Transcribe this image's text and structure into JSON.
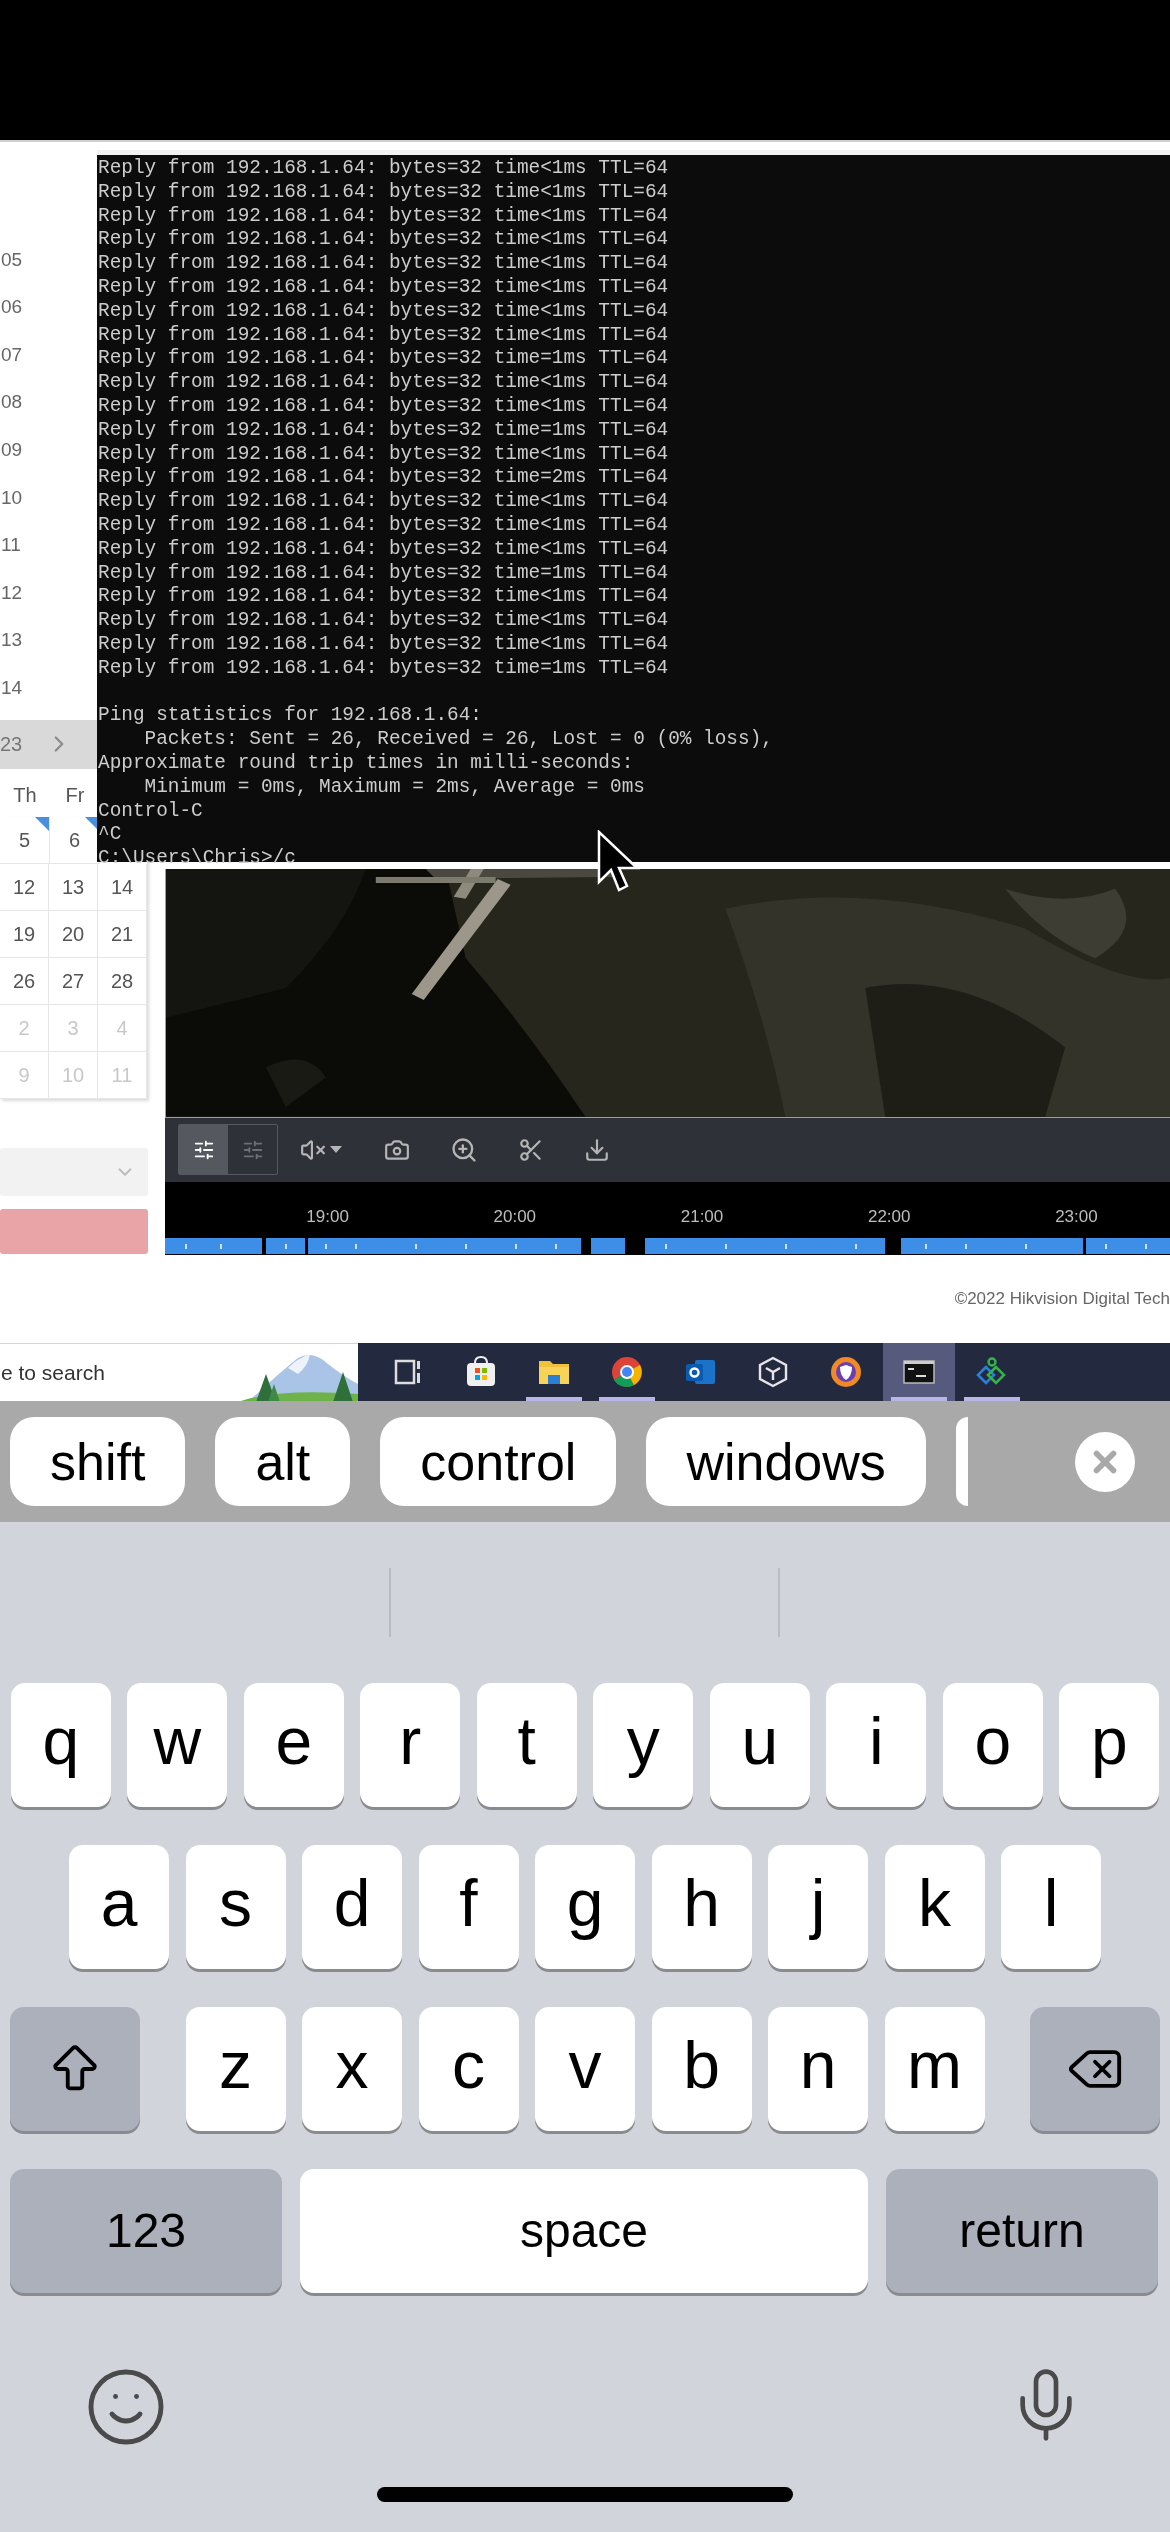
{
  "calendar": {
    "times": [
      "05",
      "06",
      "07",
      "08",
      "09",
      "10",
      "11",
      "12",
      "13",
      "14"
    ],
    "month_label": "23",
    "weekdays": [
      "Th",
      "Fr"
    ],
    "rows": [
      {
        "cells": [
          {
            "day": "5",
            "muted": false,
            "marked": true
          },
          {
            "day": "6",
            "muted": false,
            "marked": true
          }
        ]
      },
      {
        "cells": [
          {
            "day": "12",
            "muted": false,
            "marked": false
          },
          {
            "day": "13",
            "muted": false,
            "marked": false
          },
          {
            "day": "14",
            "muted": false,
            "marked": false
          }
        ]
      },
      {
        "cells": [
          {
            "day": "19",
            "muted": false,
            "marked": false
          },
          {
            "day": "20",
            "muted": false,
            "marked": false
          },
          {
            "day": "21",
            "muted": false,
            "marked": false
          }
        ]
      },
      {
        "cells": [
          {
            "day": "26",
            "muted": false,
            "marked": false
          },
          {
            "day": "27",
            "muted": false,
            "marked": false
          },
          {
            "day": "28",
            "muted": false,
            "marked": false
          }
        ]
      },
      {
        "cells": [
          {
            "day": "2",
            "muted": true,
            "marked": false
          },
          {
            "day": "3",
            "muted": true,
            "marked": false
          },
          {
            "day": "4",
            "muted": true,
            "marked": false
          }
        ]
      },
      {
        "cells": [
          {
            "day": "9",
            "muted": true,
            "marked": false
          },
          {
            "day": "10",
            "muted": true,
            "marked": false
          },
          {
            "day": "11",
            "muted": true,
            "marked": false
          }
        ]
      }
    ]
  },
  "terminal": {
    "replies": [
      "Reply from 192.168.1.64: bytes=32 time<1ms TTL=64",
      "Reply from 192.168.1.64: bytes=32 time<1ms TTL=64",
      "Reply from 192.168.1.64: bytes=32 time<1ms TTL=64",
      "Reply from 192.168.1.64: bytes=32 time<1ms TTL=64",
      "Reply from 192.168.1.64: bytes=32 time<1ms TTL=64",
      "Reply from 192.168.1.64: bytes=32 time<1ms TTL=64",
      "Reply from 192.168.1.64: bytes=32 time<1ms TTL=64",
      "Reply from 192.168.1.64: bytes=32 time<1ms TTL=64",
      "Reply from 192.168.1.64: bytes=32 time=1ms TTL=64",
      "Reply from 192.168.1.64: bytes=32 time<1ms TTL=64",
      "Reply from 192.168.1.64: bytes=32 time<1ms TTL=64",
      "Reply from 192.168.1.64: bytes=32 time=1ms TTL=64",
      "Reply from 192.168.1.64: bytes=32 time<1ms TTL=64",
      "Reply from 192.168.1.64: bytes=32 time=2ms TTL=64",
      "Reply from 192.168.1.64: bytes=32 time<1ms TTL=64",
      "Reply from 192.168.1.64: bytes=32 time<1ms TTL=64",
      "Reply from 192.168.1.64: bytes=32 time<1ms TTL=64",
      "Reply from 192.168.1.64: bytes=32 time=1ms TTL=64",
      "Reply from 192.168.1.64: bytes=32 time<1ms TTL=64",
      "Reply from 192.168.1.64: bytes=32 time<1ms TTL=64",
      "Reply from 192.168.1.64: bytes=32 time<1ms TTL=64",
      "Reply from 192.168.1.64: bytes=32 time=1ms TTL=64"
    ],
    "statistics": [
      "Ping statistics for 192.168.1.64:",
      "    Packets: Sent = 26, Received = 26, Lost = 0 (0% loss),",
      "Approximate round trip times in milli-seconds:",
      "    Minimum = 0ms, Maximum = 2ms, Average = 0ms",
      "Control-C",
      "^C",
      "C:\\Users\\Chris>/c"
    ]
  },
  "player": {
    "view_toggles": [
      {
        "selected": true
      },
      {
        "selected": false
      }
    ],
    "timeline_labels": [
      "19:00",
      "20:00",
      "21:00",
      "22:00",
      "23:00"
    ],
    "copyright": "©2022 Hikvision Digital Tech"
  },
  "taskbar": {
    "search_placeholder": "e to search",
    "apps": [
      {
        "kind": "taskview",
        "running": false,
        "selected": false
      },
      {
        "kind": "store",
        "running": false,
        "selected": false
      },
      {
        "kind": "folder",
        "running": true,
        "selected": false
      },
      {
        "kind": "globe",
        "running": true,
        "selected": false
      },
      {
        "kind": "mail",
        "running": false,
        "selected": false
      },
      {
        "kind": "cube",
        "running": false,
        "selected": false
      },
      {
        "kind": "shield",
        "running": false,
        "selected": false
      },
      {
        "kind": "terminal",
        "running": true,
        "selected": true
      },
      {
        "kind": "diamond",
        "running": true,
        "selected": false
      }
    ]
  },
  "modifier_keys": [
    "shift",
    "alt",
    "control",
    "windows"
  ],
  "keyboard": {
    "rows": [
      [
        "q",
        "w",
        "e",
        "r",
        "t",
        "y",
        "u",
        "i",
        "o",
        "p"
      ],
      [
        "a",
        "s",
        "d",
        "f",
        "g",
        "h",
        "j",
        "k",
        "l"
      ],
      [
        "z",
        "x",
        "c",
        "v",
        "b",
        "n",
        "m"
      ]
    ],
    "shift_on": false,
    "numbers_key": "123",
    "space_key": "space",
    "return_key": "return"
  }
}
